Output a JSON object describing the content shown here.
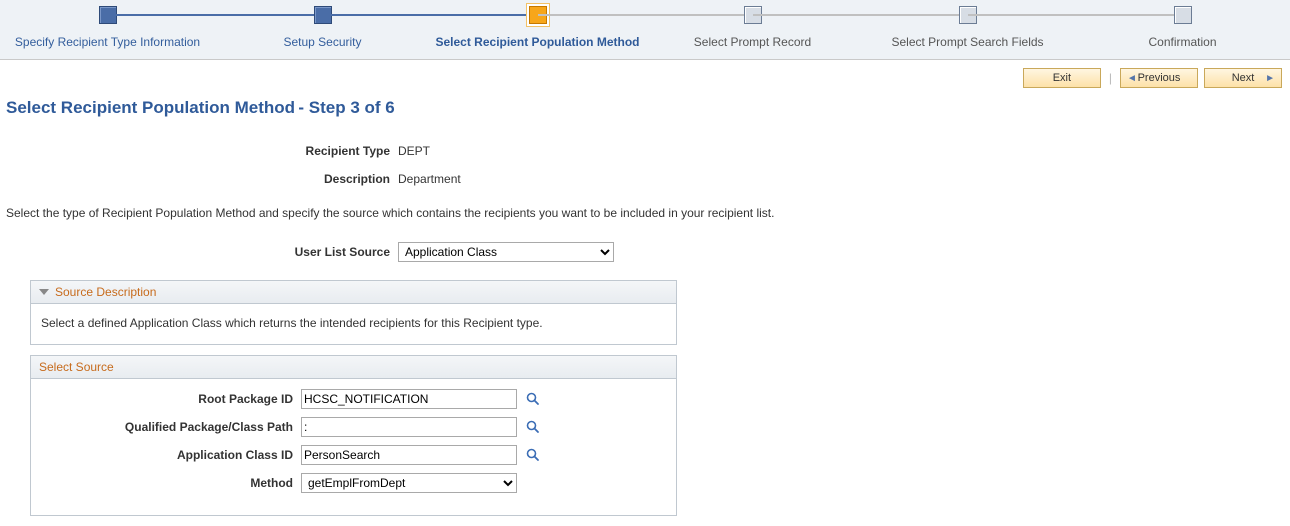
{
  "wizard": {
    "steps": [
      {
        "label": "Specify Recipient Type Information",
        "state": "done"
      },
      {
        "label": "Setup Security",
        "state": "done"
      },
      {
        "label": "Select Recipient Population Method",
        "state": "current"
      },
      {
        "label": "Select Prompt Record",
        "state": "future"
      },
      {
        "label": "Select Prompt Search Fields",
        "state": "future"
      },
      {
        "label": "Confirmation",
        "state": "future"
      }
    ]
  },
  "actions": {
    "exit": "Exit",
    "previous": "Previous",
    "next": "Next"
  },
  "title": {
    "main": "Select Recipient Population Method",
    "sub": "- Step 3 of 6"
  },
  "header_fields": {
    "recipient_type_label": "Recipient Type",
    "recipient_type_value": "DEPT",
    "description_label": "Description",
    "description_value": "Department"
  },
  "instructions": "Select the type of Recipient Population Method and specify the source which contains the recipients you want to be included in your recipient list.",
  "user_list_source": {
    "label": "User List Source",
    "value": "Application Class",
    "options": [
      "Application Class"
    ]
  },
  "source_description": {
    "heading": "Source Description",
    "text": "Select a defined Application Class which returns the intended recipients for this Recipient type."
  },
  "select_source": {
    "heading": "Select Source",
    "root_pkg_label": "Root Package ID",
    "root_pkg_value": "HCSC_NOTIFICATION",
    "qual_path_label": "Qualified Package/Class Path",
    "qual_path_value": ":",
    "app_class_label": "Application Class ID",
    "app_class_value": "PersonSearch",
    "method_label": "Method",
    "method_value": "getEmplFromDept",
    "method_options": [
      "getEmplFromDept"
    ]
  },
  "icons": {
    "lookup": "magnifier-icon"
  }
}
